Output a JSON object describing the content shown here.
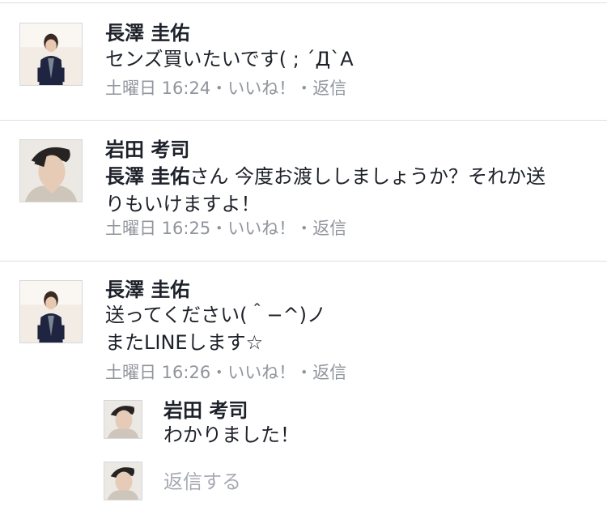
{
  "comments": [
    {
      "name": "長澤 圭佑",
      "text": "センズ買いたいです( ; ´Д`A",
      "time": "土曜日 16:24",
      "sep1": "・",
      "like": "いいね！",
      "sep2": "・",
      "reply": "返信"
    },
    {
      "name": "岩田 考司",
      "mention": "長澤 圭佑",
      "text_line1": "さん 今度お渡ししましょうか？それか送",
      "text_line2": "りもいけますよ！",
      "time": "土曜日 16:25",
      "sep1": "・",
      "like": "いいね！",
      "sep2": "・",
      "reply": "返信"
    },
    {
      "name": "長澤 圭佑",
      "text_line1": "送ってください(＾−^)ノ",
      "text_line2": "またLINEします☆",
      "time": "土曜日 16:26",
      "sep1": "・",
      "like": "いいね！",
      "sep2": "・",
      "reply": "返信"
    }
  ],
  "reply": {
    "name": "岩田 考司",
    "text": "わかりました！"
  },
  "reply_input": {
    "placeholder": "返信する"
  },
  "colors": {
    "text": "#1d2129",
    "meta": "#90949c",
    "divider": "#dddfe2",
    "placeholder": "#a7abb2"
  }
}
